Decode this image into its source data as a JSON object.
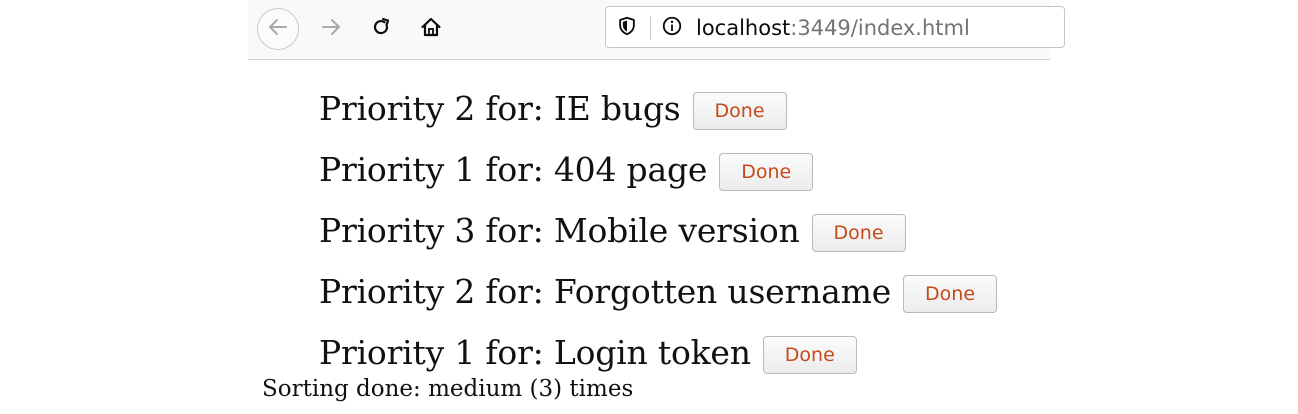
{
  "browser": {
    "url_host": "localhost",
    "url_rest": ":3449/index.html"
  },
  "tasks": [
    {
      "text": "Priority 2 for: IE bugs",
      "button_label": "Done"
    },
    {
      "text": "Priority 1 for: 404 page",
      "button_label": "Done"
    },
    {
      "text": "Priority 3 for: Mobile version",
      "button_label": "Done"
    },
    {
      "text": "Priority 2 for: Forgotten username",
      "button_label": "Done"
    },
    {
      "text": "Priority 1 for: Login token",
      "button_label": "Done"
    }
  ],
  "status_text": "Sorting done: medium (3) times",
  "colors": {
    "button_text": "#c64a1b",
    "toolbar_bg": "#f9f9fa"
  }
}
